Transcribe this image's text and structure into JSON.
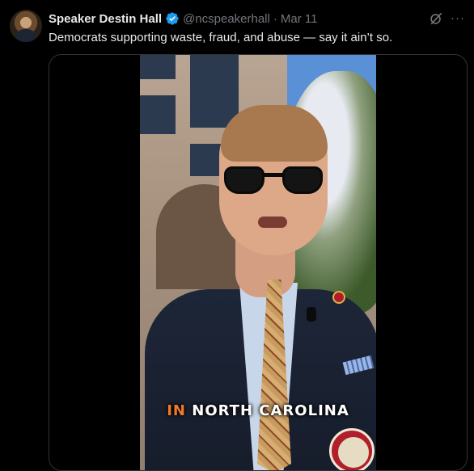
{
  "post": {
    "author_name": "Speaker Destin Hall",
    "handle": "@ncspeakerhall",
    "separator": "·",
    "date": "Mar 11",
    "text": "Democrats supporting waste, fraud, and abuse — say it ain’t so.",
    "verified": true
  },
  "actions": {
    "grok_icon": "grok-icon",
    "more_icon": "more-icon",
    "more_glyph": "···"
  },
  "media": {
    "caption_highlight": "IN",
    "caption_rest": " NORTH CAROLINA",
    "caption_highlight_color": "#f07a2a",
    "seal_icon": "nc-seal-icon"
  },
  "colors": {
    "background": "#000000",
    "text_primary": "#e7e9ea",
    "text_secondary": "#71767b",
    "verified_blue": "#1d9bf0"
  }
}
